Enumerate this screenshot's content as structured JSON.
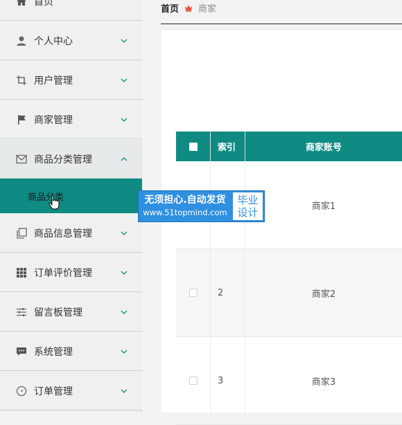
{
  "sidebar": {
    "items": [
      {
        "label": "首页",
        "icon": "home-icon"
      },
      {
        "label": "个人中心",
        "icon": "user-icon"
      },
      {
        "label": "用户管理",
        "icon": "crop-icon"
      },
      {
        "label": "商家管理",
        "icon": "flag-icon"
      },
      {
        "label": "商品分类管理",
        "icon": "mail-icon"
      },
      {
        "label": "商品信息管理",
        "icon": "copy-icon"
      },
      {
        "label": "订单评价管理",
        "icon": "grid-icon"
      },
      {
        "label": "留言板管理",
        "icon": "sliders-icon"
      },
      {
        "label": "系统管理",
        "icon": "chat-icon"
      },
      {
        "label": "订单管理",
        "icon": "compass-icon"
      }
    ],
    "submenu_active": "商品分类"
  },
  "breadcrumb": {
    "home": "首页",
    "current": "商家"
  },
  "table": {
    "headers": {
      "index": "索引",
      "account": "商家账号"
    },
    "rows": [
      {
        "index": "",
        "account": "商家1"
      },
      {
        "index": "2",
        "account": "商家2"
      },
      {
        "index": "3",
        "account": "商家3"
      }
    ]
  },
  "watermark": {
    "line1": "无须担心.自动发货",
    "line2": "www.51topmind.com",
    "badge_line1": "毕业",
    "badge_line2": "设计"
  },
  "colors": {
    "accent": "#0f8b84",
    "sidebar_bg": "#f0f0f0",
    "watermark_blue": "#2f8fe0"
  }
}
